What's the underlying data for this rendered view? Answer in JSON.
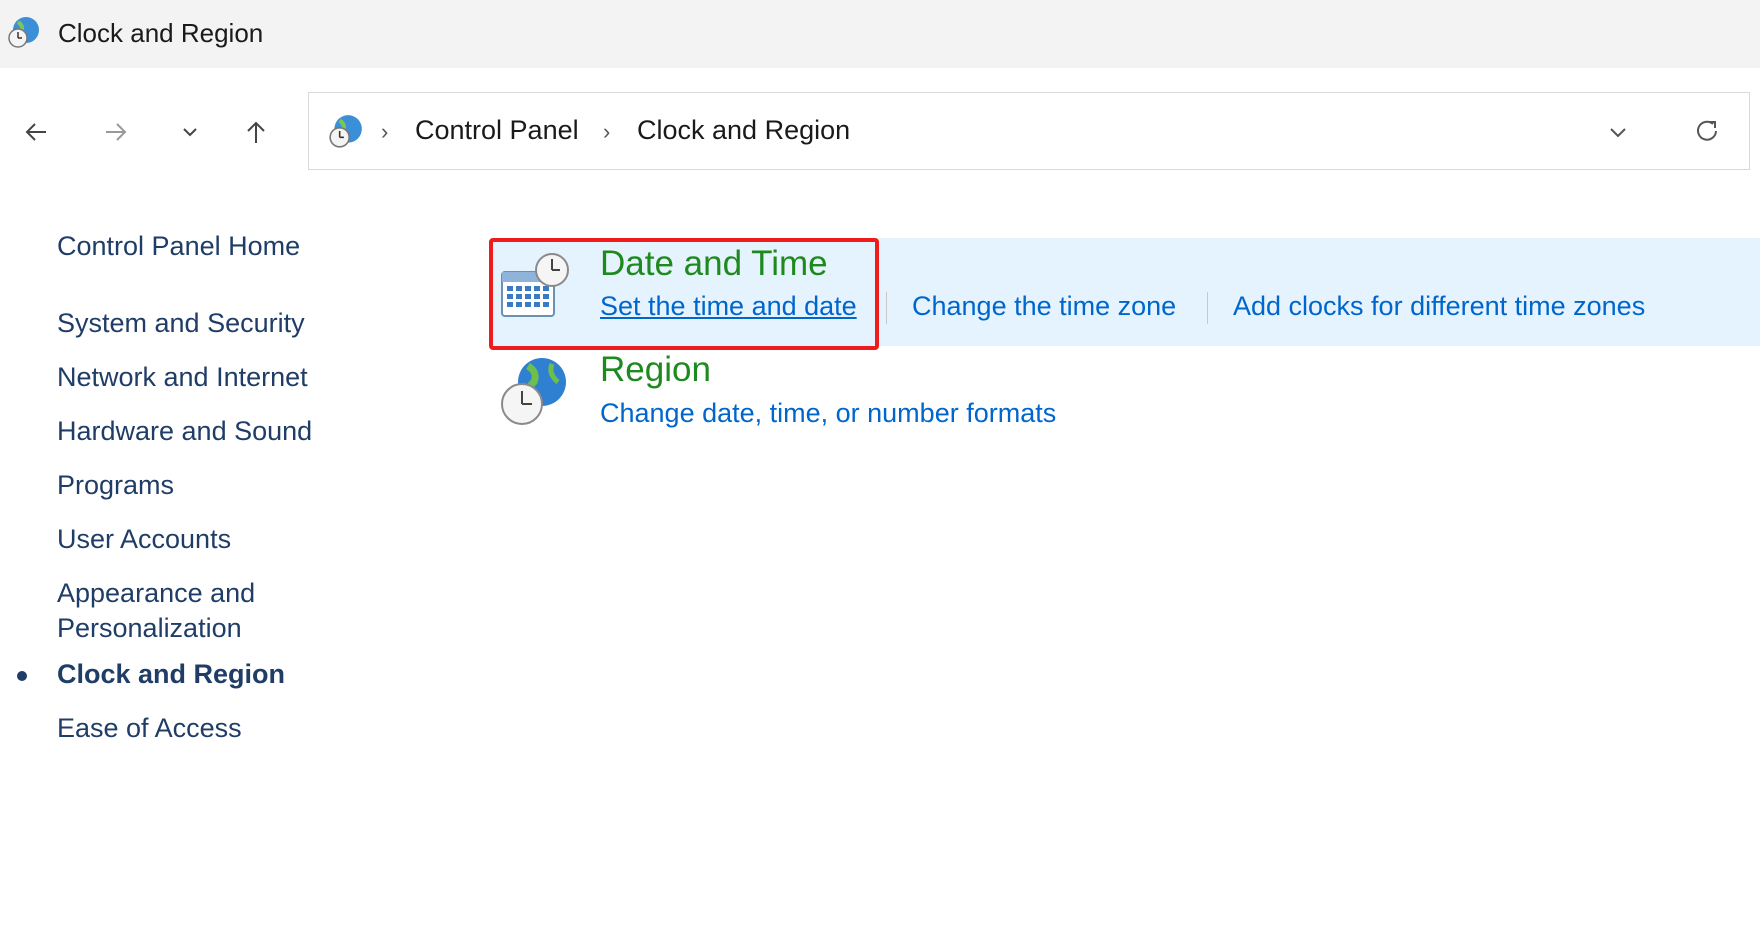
{
  "window": {
    "title": "Clock and Region"
  },
  "navigation": {
    "back_icon": "arrow-left-icon",
    "forward_icon": "arrow-right-icon",
    "recent_icon": "chevron-down-icon",
    "up_icon": "arrow-up-icon"
  },
  "address": {
    "crumbs": [
      "Control Panel",
      "Clock and Region"
    ],
    "separator": "›"
  },
  "sidebar": {
    "items": [
      {
        "label": "Control Panel Home"
      },
      {
        "label": "System and Security"
      },
      {
        "label": "Network and Internet"
      },
      {
        "label": "Hardware and Sound"
      },
      {
        "label": "Programs"
      },
      {
        "label": "User Accounts"
      },
      {
        "label_line1": "Appearance and",
        "label_line2": "Personalization"
      },
      {
        "label": "Clock and Region",
        "active": true
      },
      {
        "label": "Ease of Access"
      }
    ]
  },
  "categories": {
    "date_time": {
      "title": "Date and Time",
      "tasks": [
        "Set the time and date",
        "Change the time zone",
        "Add clocks for different time zones"
      ]
    },
    "region": {
      "title": "Region",
      "tasks": [
        "Change date, time, or number formats"
      ]
    }
  },
  "colors": {
    "category_title": "#1e8a1e",
    "task_link": "#0066cc",
    "highlight_bg": "#e5f3ff",
    "annotation_box": "#ee1c1c",
    "sidebar_link": "#1f3d66"
  }
}
